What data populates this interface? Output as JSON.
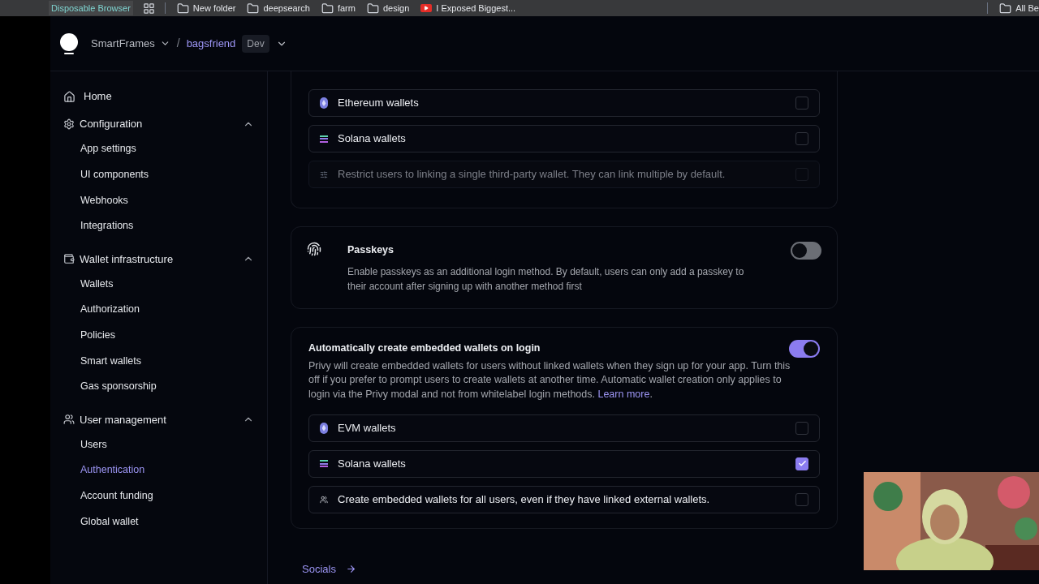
{
  "browser": {
    "app_label": "Disposable Browser",
    "bookmarks": [
      {
        "label": "New folder",
        "kind": "folder"
      },
      {
        "label": "deepsearch",
        "kind": "folder"
      },
      {
        "label": "farm",
        "kind": "folder"
      },
      {
        "label": "design",
        "kind": "folder"
      },
      {
        "label": "I Exposed Biggest...",
        "kind": "video"
      }
    ],
    "trailing_bookmark": {
      "label": "All Be",
      "kind": "folder"
    }
  },
  "header": {
    "org": "SmartFrames",
    "separator": "/",
    "project": "bagsfriend",
    "env": "Dev"
  },
  "sidebar": [
    {
      "kind": "link",
      "label": "Home",
      "selected": false
    },
    {
      "kind": "section",
      "label": "Configuration",
      "expanded": true,
      "children": [
        {
          "label": "App settings",
          "selected": false
        },
        {
          "label": "UI components",
          "selected": false
        },
        {
          "label": "Webhooks",
          "selected": false
        },
        {
          "label": "Integrations",
          "selected": false
        }
      ]
    },
    {
      "kind": "section",
      "label": "Wallet infrastructure",
      "expanded": true,
      "children": [
        {
          "label": "Wallets",
          "selected": false
        },
        {
          "label": "Authorization",
          "selected": false
        },
        {
          "label": "Policies",
          "selected": false
        },
        {
          "label": "Smart wallets",
          "selected": false
        },
        {
          "label": "Gas sponsorship",
          "selected": false
        }
      ]
    },
    {
      "kind": "section",
      "label": "User management",
      "expanded": true,
      "children": [
        {
          "label": "Users",
          "selected": false
        },
        {
          "label": "Authentication",
          "selected": true
        },
        {
          "label": "Account funding",
          "selected": false
        },
        {
          "label": "Global wallet",
          "selected": false
        }
      ]
    }
  ],
  "external_wallets": {
    "rows": [
      {
        "kind": "ethereum",
        "label": "Ethereum wallets",
        "checked": false,
        "disabled": false
      },
      {
        "kind": "solana",
        "label": "Solana wallets",
        "checked": false,
        "disabled": false
      },
      {
        "kind": "restrict",
        "label": "Restrict users to linking a single third-party wallet. They can link multiple by default.",
        "checked": false,
        "disabled": true
      }
    ]
  },
  "passkeys": {
    "title": "Passkeys",
    "description": "Enable passkeys as an additional login method. By default, users can only add a passkey to their account after signing up with another method first",
    "on": false
  },
  "auto_create": {
    "title": "Automatically create embedded wallets on login",
    "description": "Privy will create embedded wallets for users without linked wallets when they sign up for your app. Turn this off if you prefer to prompt users to create wallets at another time. Automatic wallet creation only applies to login via the Privy modal and not from whitelabel login methods.",
    "link": "Learn more",
    "link_suffix": ".",
    "on": true,
    "rows": [
      {
        "kind": "ethereum",
        "label": "EVM wallets",
        "checked": false,
        "disabled": false
      },
      {
        "kind": "solana",
        "label": "Solana wallets",
        "checked": true,
        "disabled": false
      },
      {
        "kind": "users",
        "label": "Create embedded wallets for all users, even if they have linked external wallets.",
        "checked": false,
        "disabled": false
      }
    ]
  },
  "next_link": {
    "label": "Socials"
  }
}
